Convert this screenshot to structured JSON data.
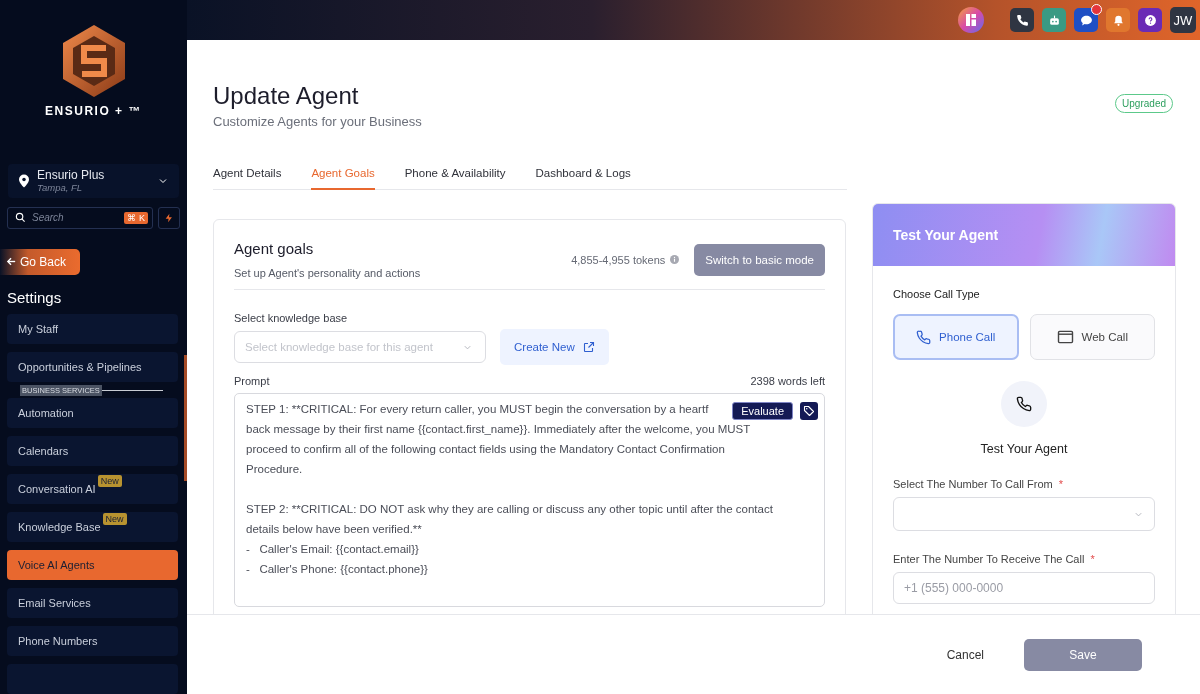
{
  "top_bar": {
    "message_notification": true,
    "avatar_initials": "JW"
  },
  "sidebar": {
    "brand": "ENSURIO + ™",
    "location": {
      "name": "Ensurio Plus",
      "city": "Tampa, FL"
    },
    "search": {
      "placeholder": "Search",
      "shortcut": "⌘ K"
    },
    "back_button": "Go Back",
    "section_title": "Settings",
    "items": [
      {
        "kind": "item",
        "label": "My Staff",
        "selected": false
      },
      {
        "kind": "item",
        "label": "Opportunities & Pipelines",
        "selected": false
      },
      {
        "kind": "header",
        "label": "BUSINESS SERVICES"
      },
      {
        "kind": "item",
        "label": "Automation",
        "selected": false
      },
      {
        "kind": "item",
        "label": "Calendars",
        "selected": false
      },
      {
        "kind": "item",
        "label": "Conversation AI",
        "badge": "New",
        "selected": false
      },
      {
        "kind": "item",
        "label": "Knowledge Base",
        "badge": "New",
        "selected": false
      },
      {
        "kind": "item",
        "label": "Voice AI Agents",
        "selected": true
      },
      {
        "kind": "item",
        "label": "Email Services",
        "selected": false
      },
      {
        "kind": "item",
        "label": "Phone Numbers",
        "selected": false
      }
    ]
  },
  "page": {
    "title": "Update Agent",
    "subtitle": "Customize Agents for your Business",
    "plan_badge": "Upgraded"
  },
  "tabs": [
    {
      "label": "Agent Details",
      "selected": false
    },
    {
      "label": "Agent Goals",
      "selected": true
    },
    {
      "label": "Phone & Availability",
      "selected": false
    },
    {
      "label": "Dashboard & Logs",
      "selected": false
    }
  ],
  "goals_card": {
    "title": "Agent goals",
    "subtitle": "Set up Agent's personality and actions",
    "tokens": "4,855-4,955 tokens",
    "mode_button": "Switch to basic mode",
    "knowledge_base": {
      "label": "Select knowledge base",
      "placeholder": "Select knowledge base for this agent",
      "create_button": "Create New"
    },
    "prompt": {
      "label": "Prompt",
      "words_left": "2398 words left",
      "evaluate_button": "Evaluate",
      "paragraphs": [
        [
          "STEP 1: **CRITICAL: For every return caller, you MUST begin the conversation by a heartf",
          "back message by their first name {{contact.first_name}}. Immediately after the welcome, you MUST",
          "proceed to confirm all of the following contact fields using the Mandatory Contact Confirmation",
          "Procedure."
        ],
        [
          "STEP 2: **CRITICAL: DO NOT ask why they are calling or discuss any other topic until after the contact",
          "details below have been verified.**",
          "-   Caller's Email: {{contact.email}}",
          "-   Caller's Phone: {{contact.phone}}"
        ]
      ]
    }
  },
  "test_card": {
    "title": "Test Your Agent",
    "call_type_label": "Choose Call Type",
    "call_types": [
      {
        "kind": "phone",
        "label": "Phone Call",
        "selected": true
      },
      {
        "kind": "web",
        "label": "Web Call",
        "selected": false
      }
    ],
    "heading": "Test Your Agent",
    "from_field": {
      "label": "Select The Number To Call From",
      "required_mark": "*"
    },
    "to_field": {
      "label": "Enter The Number To Receive The Call",
      "required_mark": "*",
      "placeholder": "+1 (555) 000-0000"
    }
  },
  "footer": {
    "cancel": "Cancel",
    "save": "Save"
  }
}
